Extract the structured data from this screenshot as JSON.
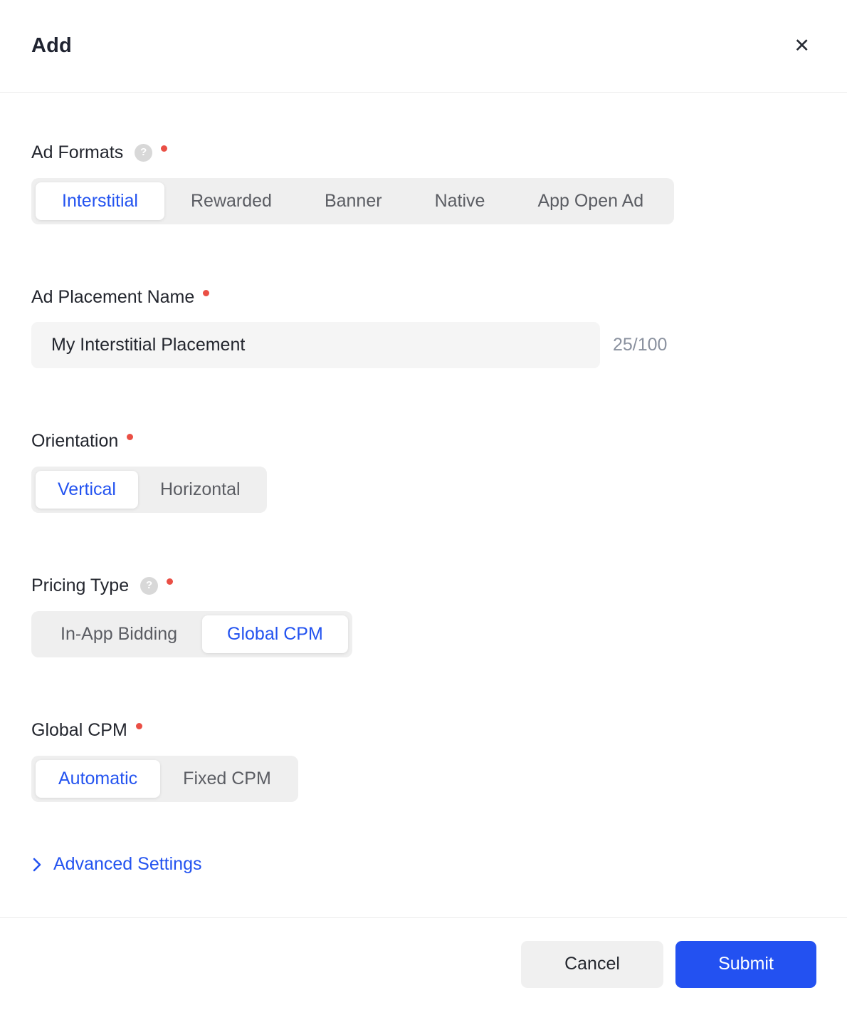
{
  "modal": {
    "title": "Add",
    "close_glyph": "✕"
  },
  "form": {
    "ad_formats": {
      "label": "Ad Formats",
      "selected": "Interstitial",
      "options": [
        "Interstitial",
        "Rewarded",
        "Banner",
        "Native",
        "App Open Ad"
      ]
    },
    "ad_placement_name": {
      "label": "Ad Placement Name",
      "value": "My Interstitial Placement",
      "counter": "25/100"
    },
    "orientation": {
      "label": "Orientation",
      "selected": "Vertical",
      "options": [
        "Vertical",
        "Horizontal"
      ]
    },
    "pricing_type": {
      "label": "Pricing Type",
      "selected": "Global CPM",
      "options": [
        "In-App Bidding",
        "Global CPM"
      ]
    },
    "global_cpm": {
      "label": "Global CPM",
      "selected": "Automatic",
      "options": [
        "Automatic",
        "Fixed CPM"
      ]
    },
    "advanced_settings_label": "Advanced Settings",
    "help_glyph": "?"
  },
  "footer": {
    "cancel_label": "Cancel",
    "submit_label": "Submit"
  },
  "colors": {
    "accent_blue": "#2353F0",
    "required_red": "#EA4F45",
    "segment_bg": "#EFEFEF",
    "input_bg": "#F5F5F5",
    "submit_bg": "#2351F1"
  }
}
